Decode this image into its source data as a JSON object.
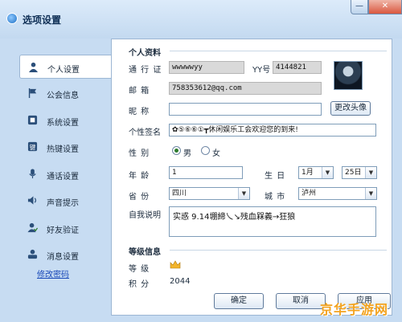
{
  "window": {
    "title": "选项设置",
    "minimize_glyph": "—",
    "close_glyph": "✕"
  },
  "sidebar": {
    "items": [
      {
        "label": "个人设置",
        "icon": "person-icon",
        "active": true
      },
      {
        "label": "公会信息",
        "icon": "flag-icon"
      },
      {
        "label": "系统设置",
        "icon": "system-icon"
      },
      {
        "label": "热键设置",
        "icon": "keyboard-icon"
      },
      {
        "label": "通话设置",
        "icon": "microphone-icon"
      },
      {
        "label": "声音提示",
        "icon": "speaker-icon"
      },
      {
        "label": "好友验证",
        "icon": "friend-verify-icon"
      },
      {
        "label": "消息设置",
        "icon": "message-icon"
      }
    ],
    "change_password": "修改密码"
  },
  "profile": {
    "section_title": "个人资料",
    "pass_label": "通 行 证",
    "pass_value": "wwwwwyy",
    "yy_label": "YY号",
    "yy_value": "4144821",
    "email_label": "邮    箱",
    "email_value": "758353612@qq.com",
    "nickname_label": "昵    称",
    "nickname_value": "",
    "change_avatar_button": "更改头像",
    "signature_label": "个性签名",
    "signature_value": "✿⑤⑥⑥①┳休闲娱乐工会欢迎您的到来!",
    "gender_label": "性    别",
    "gender_male": "男",
    "gender_female": "女",
    "gender_selected": "male",
    "age_label": "年    龄",
    "age_value": "1",
    "birthday_label": "生    日",
    "birth_month": "1月",
    "birth_day": "25日",
    "province_label": "省    份",
    "province_value": "四川",
    "city_label": "城    市",
    "city_value": "泸州",
    "bio_label": "自我说明",
    "bio_value": "实惑 9.14堋締乀↘残血槑義→狂狼"
  },
  "level": {
    "section_title": "等级信息",
    "grade_label": "等    级",
    "grade_icon": "crown-icon",
    "points_label": "积    分",
    "points_value": "2044"
  },
  "buttons": {
    "ok": "确定",
    "cancel": "取消",
    "apply": "应用"
  },
  "watermark": "京华手游网",
  "colors": {
    "frame": "#c7dcf2",
    "accent_link": "#1848b8",
    "watermark": "#f3a31f",
    "close_button": "#d9573f"
  }
}
